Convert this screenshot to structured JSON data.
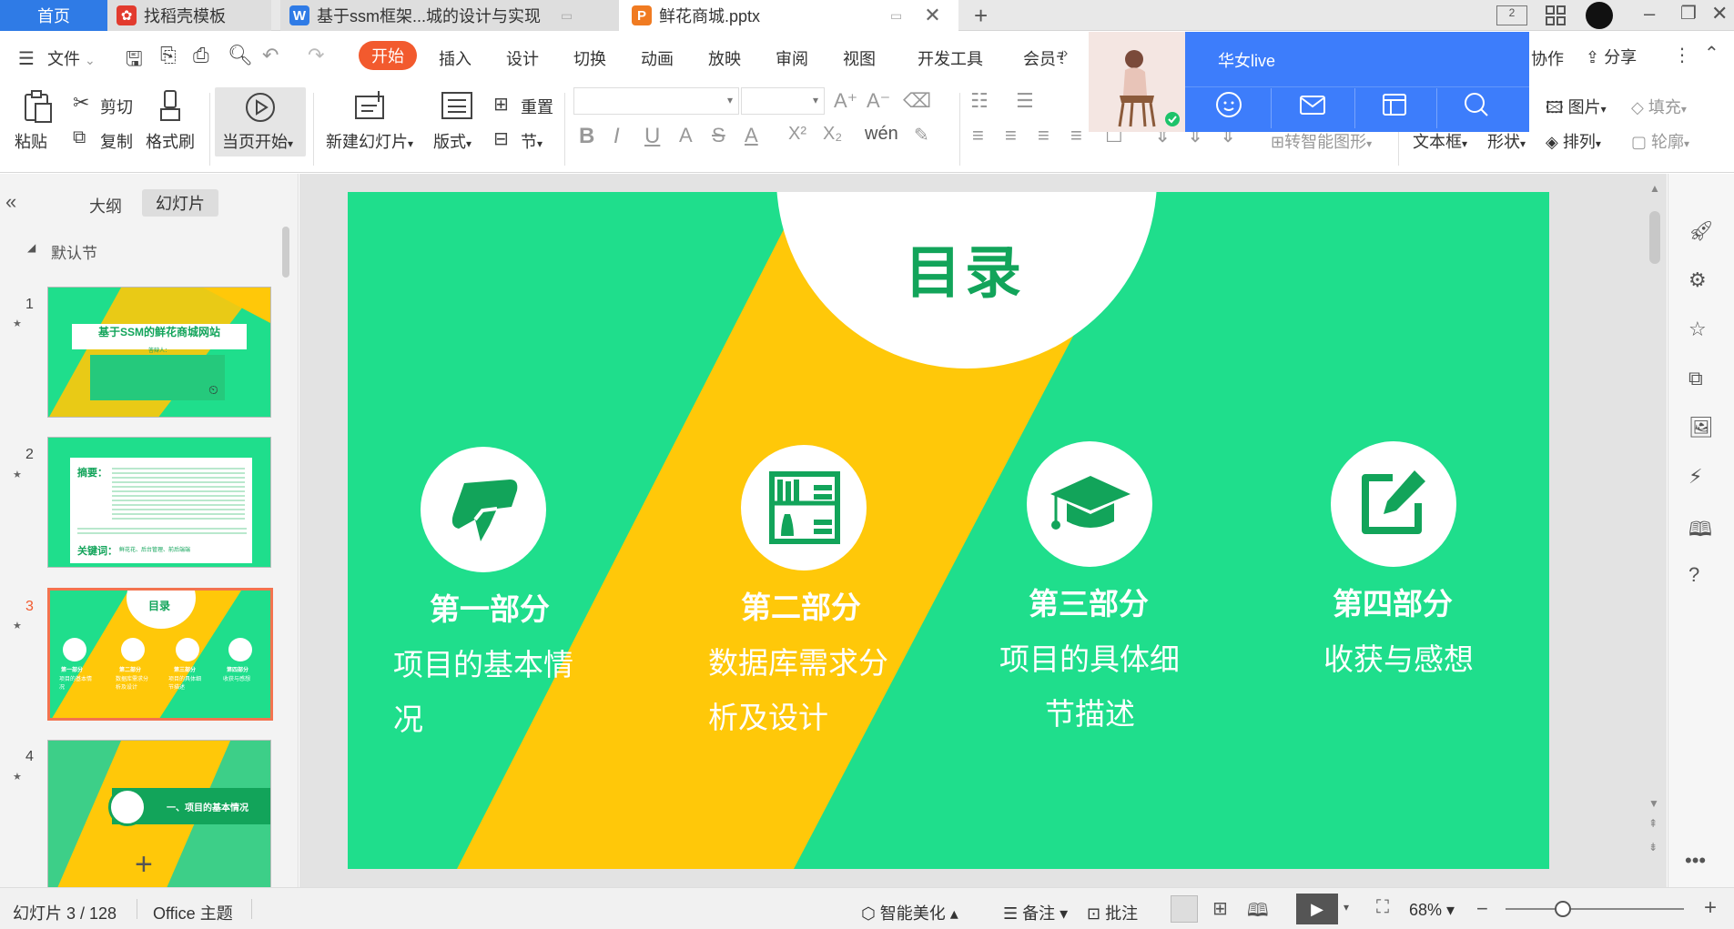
{
  "tabs": {
    "home": "首页",
    "zhaodaoke": "找稻壳模板",
    "word": "基于ssm框架...城的设计与实现",
    "ppt": "鲜花商城.pptx"
  },
  "menu": {
    "file": "文件",
    "items": [
      "开始",
      "插入",
      "设计",
      "切换",
      "动画",
      "放映",
      "审阅",
      "视图",
      "开发工具",
      "会员专"
    ],
    "collab": "协作",
    "share": "分享"
  },
  "ribbon": {
    "paste": "粘贴",
    "cut": "剪切",
    "copy": "复制",
    "format_painter": "格式刷",
    "from_current": "当页开始",
    "new_slide": "新建幻灯片",
    "layout": "版式",
    "reset": "重置",
    "section": "节",
    "convert_smart": "转智能图形",
    "textbox": "文本框",
    "shape": "形状",
    "picture": "图片",
    "fill": "填充",
    "arrange": "排列",
    "outline": "轮廓"
  },
  "overlay": {
    "title": "华女live"
  },
  "panel": {
    "outline_tab": "大纲",
    "slides_tab": "幻灯片",
    "section": "默认节",
    "nums": [
      "1",
      "2",
      "3",
      "4"
    ]
  },
  "thumbs": {
    "t1_title": "基于SSM的鲜花商城网站",
    "t1_sub": "答辩人：",
    "t2_head": "摘要：",
    "t2_kw": "关键词：",
    "t2_kwtext": "鲜花花、后台管理、前后端端",
    "t3_title": "目录",
    "t3_parts": [
      "第一部分",
      "第二部分",
      "第三部分",
      "第四部分"
    ],
    "t3_subs": [
      "项目的基本情况",
      "数据库需求分析及设计",
      "项目的具体细节描述",
      "收获与感想"
    ],
    "t4_text": "一、项目的基本情况"
  },
  "slide": {
    "title": "目录",
    "sections": [
      {
        "head": "第一部分",
        "lines": [
          "项目的基本情",
          "况"
        ]
      },
      {
        "head": "第二部分",
        "lines": [
          "数据库需求分",
          "析及设计"
        ]
      },
      {
        "head": "第三部分",
        "lines": [
          "项目的具体细",
          "节描述"
        ]
      },
      {
        "head": "第四部分",
        "lines": [
          "收获与感想"
        ]
      }
    ],
    "colors": {
      "green": "#1fde8c",
      "yellow": "#ffc809",
      "dark_green": "#12a45a"
    }
  },
  "status": {
    "slide_counter": "幻灯片 3 / 128",
    "theme": "Office 主题",
    "beautify": "智能美化",
    "notes": "备注",
    "comments": "批注",
    "zoom": "68%"
  }
}
